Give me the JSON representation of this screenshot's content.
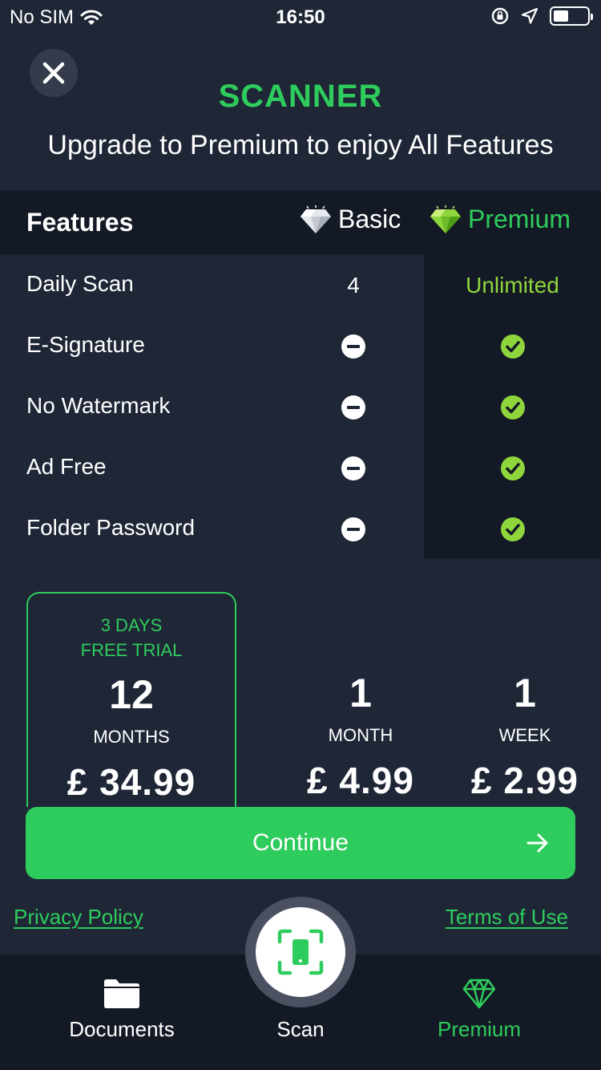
{
  "status_bar": {
    "carrier": "No SIM",
    "time": "16:50"
  },
  "header": {
    "close_icon": "close-icon",
    "app_title": "SCANNER",
    "subtitle": "Upgrade to Premium to enjoy All Features"
  },
  "table": {
    "col_features": "Features",
    "col_basic": "Basic",
    "col_premium": "Premium",
    "rows": [
      {
        "label": "Daily Scan",
        "basic": "4",
        "premium": "Unlimited"
      },
      {
        "label": "E-Signature",
        "basic": "minus-icon",
        "premium": "check-icon"
      },
      {
        "label": "No Watermark",
        "basic": "minus-icon",
        "premium": "check-icon"
      },
      {
        "label": "Ad Free",
        "basic": "minus-icon",
        "premium": "check-icon"
      },
      {
        "label": "Folder Password",
        "basic": "minus-icon",
        "premium": "check-icon"
      }
    ]
  },
  "plans": [
    {
      "trial_line1": "3 DAYS",
      "trial_line2": "FREE TRIAL",
      "number": "12",
      "unit": "MONTHS",
      "price": "£ 34.99",
      "selected": true
    },
    {
      "number": "1",
      "unit": "MONTH",
      "price": "£ 4.99",
      "selected": false
    },
    {
      "number": "1",
      "unit": "WEEK",
      "price": "£ 2.99",
      "selected": false
    }
  ],
  "continue_label": "Continue",
  "links": {
    "privacy": "Privacy Policy",
    "terms": "Terms of Use"
  },
  "tabs": [
    {
      "label": "Documents",
      "icon": "folder-icon"
    },
    {
      "label": "Scan",
      "icon": "scan-icon"
    },
    {
      "label": "Premium",
      "icon": "diamond-icon"
    }
  ],
  "colors": {
    "accent": "#2ecc5c",
    "check": "#8fd63c",
    "background": "#1f2737",
    "dark": "#141a25"
  }
}
